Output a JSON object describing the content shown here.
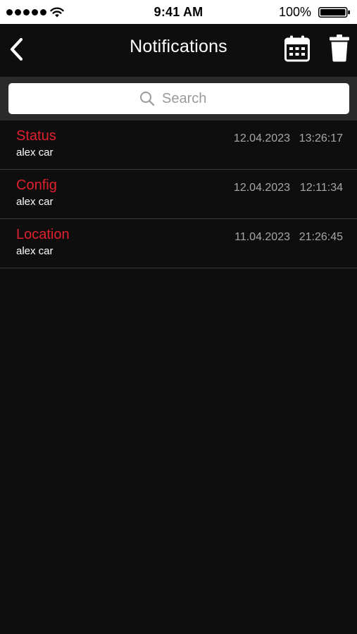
{
  "status_bar": {
    "time": "9:41 AM",
    "battery_percent": "100%",
    "signal_icon": "signal-dots-icon",
    "wifi_icon": "wifi-icon",
    "battery_icon": "battery-icon"
  },
  "nav": {
    "title": "Notifications",
    "back_icon": "chevron-left-icon",
    "calendar_icon": "calendar-icon",
    "trash_icon": "trash-icon"
  },
  "search": {
    "placeholder": "Search",
    "value": "",
    "icon": "search-icon"
  },
  "notifications": [
    {
      "title": "Status",
      "subtitle": "alex car",
      "date": "12.04.2023",
      "time": "13:26:17"
    },
    {
      "title": "Config",
      "subtitle": "alex car",
      "date": "12.04.2023",
      "time": "12:11:34"
    },
    {
      "title": "Location",
      "subtitle": "alex car",
      "date": "11.04.2023",
      "time": "21:26:45"
    }
  ],
  "colors": {
    "background": "#0e0e0f",
    "accent_red": "#e0202e",
    "search_bar_bg": "#2a2a2b",
    "secondary_text": "#a7a7a7",
    "divider": "#3a3a3b"
  }
}
